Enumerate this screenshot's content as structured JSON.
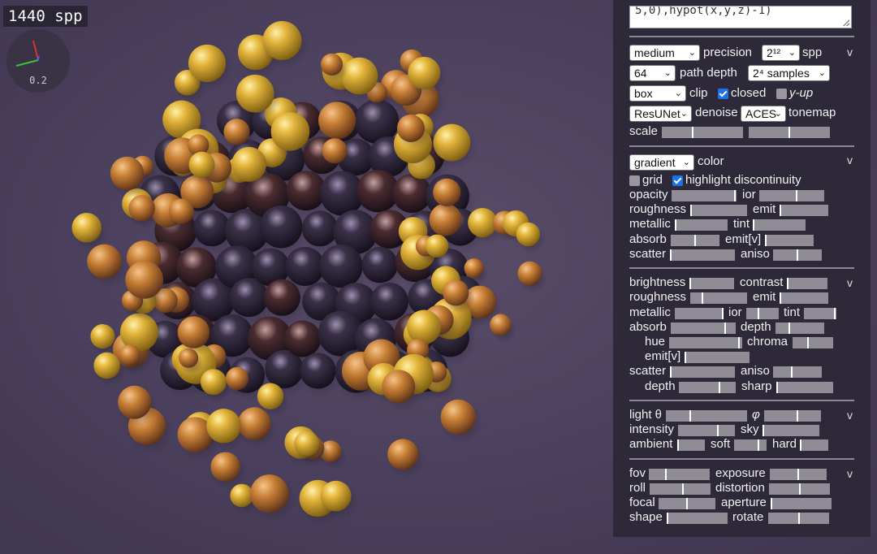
{
  "render": {
    "spp_counter": "1440 spp",
    "axes_scale": "0.2",
    "colors": {
      "gold": "#e2b43a",
      "dark_orange": "#b8702a",
      "obsidian": "#2a2235",
      "background": "#4a3f5c"
    }
  },
  "panel": {
    "expression_text": "5,0),hypot(x,y,z)-1)",
    "collapse_glyph": "v",
    "render_section": {
      "precision_select": "medium",
      "precision_label": "precision",
      "spp_select": "2¹²",
      "spp_label": "spp",
      "path_depth_select": "64",
      "path_depth_label": "path depth",
      "samples_select": "2⁴ samples",
      "clip_select": "box",
      "clip_label": "clip",
      "closed_label": "closed",
      "closed_checked": true,
      "yup_label": "y-up",
      "yup_checked": false,
      "denoise_select": "ResUNet",
      "denoise_label": "denoise",
      "tonemap_select": "ACES",
      "tonemap_label": "tonemap",
      "scale_label": "scale",
      "scale_value_1": 0.38,
      "scale_value_2": 0.5
    },
    "color_section": {
      "color_select": "gradient",
      "color_label": "color",
      "grid_label": "grid",
      "grid_checked": false,
      "highlight_label": "highlight discontinuity",
      "highlight_checked": true,
      "opacity_label": "opacity",
      "opacity": 0.98,
      "ior_label": "ior",
      "ior": 0.58,
      "roughness_label": "roughness",
      "roughness": 0.0,
      "emit_label": "emit",
      "emit": 0.02,
      "metallic_label": "metallic",
      "metallic": 0.0,
      "tint_label": "tint",
      "tint": 0.0,
      "absorb_label": "absorb",
      "absorb": 0.5,
      "emitv_label": "emit[v]",
      "emitv": 0.0,
      "scatter_label": "scatter",
      "scatter": 0.0,
      "aniso_label": "aniso",
      "aniso": 0.5
    },
    "material_section": {
      "brightness_label": "brightness",
      "brightness": 0.0,
      "contrast_label": "contrast",
      "contrast": 0.0,
      "roughness_label": "roughness",
      "roughness": 0.22,
      "emit_label": "emit",
      "emit": 0.0,
      "metallic_label": "metallic",
      "metallic": 1.0,
      "ior_label": "ior",
      "ior": 0.38,
      "tint_label": "tint",
      "tint": 0.96,
      "absorb_label": "absorb",
      "absorb": 0.84,
      "depth_label": "depth",
      "depth": 0.28,
      "hue_label": "hue",
      "hue": 0.96,
      "chroma_label": "chroma",
      "chroma": 0.38,
      "emitv_label": "emit[v]",
      "emitv": 0.0,
      "scatter_label": "scatter",
      "scatter": 0.0,
      "aniso_label": "aniso",
      "aniso": 0.38,
      "depth2_label": "depth",
      "depth2": 0.72,
      "sharp_label": "sharp",
      "sharp": 0.0
    },
    "light_section": {
      "theta_label": "light θ",
      "theta": 0.3,
      "phi_label": "φ",
      "phi": 0.58,
      "intensity_label": "intensity",
      "intensity": 0.7,
      "sky_label": "sky",
      "sky": 0.0,
      "ambient_label": "ambient",
      "ambient": 0.0,
      "soft_label": "soft",
      "soft": 0.75,
      "hard_label": "hard",
      "hard": 0.0
    },
    "camera_section": {
      "fov_label": "fov",
      "fov": 0.28,
      "exposure_label": "exposure",
      "exposure": 0.5,
      "roll_label": "roll",
      "roll": 0.54,
      "distortion_label": "distortion",
      "distortion": 0.51,
      "focal_label": "focal",
      "focal": 0.5,
      "aperture_label": "aperture",
      "aperture": 0.0,
      "shape_label": "shape",
      "shape": 0.0,
      "rotate_label": "rotate",
      "rotate": 0.5
    }
  }
}
